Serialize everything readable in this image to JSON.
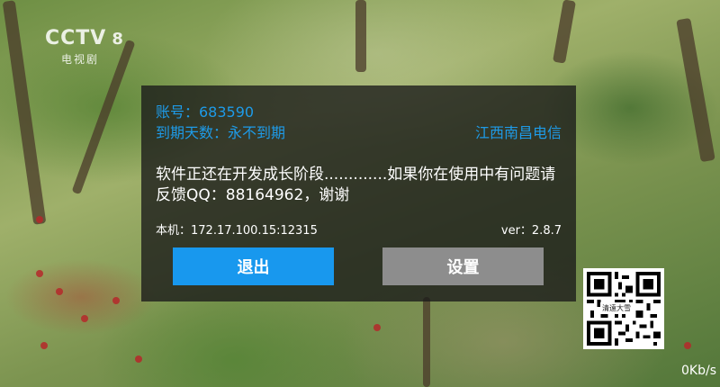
{
  "overlay": {
    "channel_brand": "CCTV",
    "channel_number": "8",
    "channel_subtitle": "电视剧"
  },
  "dialog": {
    "account_label": "账号：683590",
    "expiry_label": "到期天数：永不到期",
    "isp": "江西南昌电信",
    "message": "软件正还在开发成长阶段.............如果你在使用中有问题请反馈QQ：88164962，谢谢",
    "local_ip": "本机：172.17.100.15:12315",
    "version": "ver：2.8.7",
    "exit_button": "退出",
    "settings_button": "设置"
  },
  "qr": {
    "label": "清遠大雪"
  },
  "status": {
    "network_speed": "0Kb/s"
  },
  "colors": {
    "accent": "#1898ee",
    "secondary_button": "#8d8d8d",
    "dialog_bg": "rgba(25,25,25,0.78)"
  }
}
